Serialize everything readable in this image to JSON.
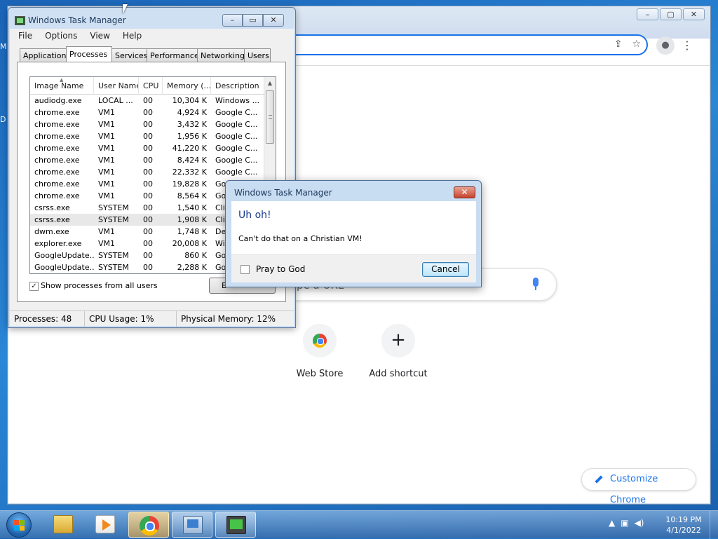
{
  "desktop": {
    "edge_texts": [
      "M",
      "D"
    ]
  },
  "chrome": {
    "search_placeholder": "pe a URL",
    "shortcuts": [
      {
        "label": "Web Store",
        "icon": "chrome-webstore-icon"
      },
      {
        "label": "Add shortcut",
        "icon": "plus-icon",
        "glyph": "+"
      }
    ],
    "customize_label": "Customize Chrome"
  },
  "task_manager": {
    "title": "Windows Task Manager",
    "menu": [
      "File",
      "Options",
      "View",
      "Help"
    ],
    "tabs": [
      "Applications",
      "Processes",
      "Services",
      "Performance",
      "Networking",
      "Users"
    ],
    "active_tab": "Processes",
    "columns": [
      "Image Name",
      "User Name",
      "CPU",
      "Memory (...",
      "Description"
    ],
    "rows": [
      {
        "image": "audiodg.exe",
        "user": "LOCAL ...",
        "cpu": "00",
        "mem": "10,304 K",
        "desc": "Windows ..."
      },
      {
        "image": "chrome.exe",
        "user": "VM1",
        "cpu": "00",
        "mem": "4,924 K",
        "desc": "Google C..."
      },
      {
        "image": "chrome.exe",
        "user": "VM1",
        "cpu": "00",
        "mem": "3,432 K",
        "desc": "Google C..."
      },
      {
        "image": "chrome.exe",
        "user": "VM1",
        "cpu": "00",
        "mem": "1,956 K",
        "desc": "Google C..."
      },
      {
        "image": "chrome.exe",
        "user": "VM1",
        "cpu": "00",
        "mem": "41,220 K",
        "desc": "Google C..."
      },
      {
        "image": "chrome.exe",
        "user": "VM1",
        "cpu": "00",
        "mem": "8,424 K",
        "desc": "Google C..."
      },
      {
        "image": "chrome.exe",
        "user": "VM1",
        "cpu": "00",
        "mem": "22,332 K",
        "desc": "Google C..."
      },
      {
        "image": "chrome.exe",
        "user": "VM1",
        "cpu": "00",
        "mem": "19,828 K",
        "desc": "Google C..."
      },
      {
        "image": "chrome.exe",
        "user": "VM1",
        "cpu": "00",
        "mem": "8,564 K",
        "desc": "Goo"
      },
      {
        "image": "csrss.exe",
        "user": "SYSTEM",
        "cpu": "00",
        "mem": "1,540 K",
        "desc": "Clie"
      },
      {
        "image": "csrss.exe",
        "user": "SYSTEM",
        "cpu": "00",
        "mem": "1,908 K",
        "desc": "Clie"
      },
      {
        "image": "dwm.exe",
        "user": "VM1",
        "cpu": "00",
        "mem": "1,748 K",
        "desc": "Des"
      },
      {
        "image": "explorer.exe",
        "user": "VM1",
        "cpu": "00",
        "mem": "20,008 K",
        "desc": "Win"
      },
      {
        "image": "GoogleUpdate...",
        "user": "SYSTEM",
        "cpu": "00",
        "mem": "860 K",
        "desc": "Goo"
      },
      {
        "image": "GoogleUpdate...",
        "user": "SYSTEM",
        "cpu": "00",
        "mem": "2,288 K",
        "desc": "Goo"
      }
    ],
    "selected_row": 10,
    "show_all_label": "Show processes from all users",
    "show_all_checked": true,
    "end_button_label": "E",
    "status": {
      "processes": "Processes: 48",
      "cpu": "CPU Usage: 1%",
      "memory": "Physical Memory: 12%"
    }
  },
  "dialog": {
    "title": "Windows Task Manager",
    "heading": "Uh oh!",
    "message": "Can't do that on a Christian VM!",
    "checkbox_label": "Pray to God",
    "checkbox_checked": false,
    "cancel_label": "Cancel"
  },
  "taskbar": {
    "apps": [
      "windows-explorer",
      "windows-media-player",
      "google-chrome",
      "remote-desktop",
      "task-manager"
    ],
    "active_app": "task-manager",
    "highlighted_app": "google-chrome",
    "time": "10:19 PM",
    "date": "4/1/2022"
  }
}
